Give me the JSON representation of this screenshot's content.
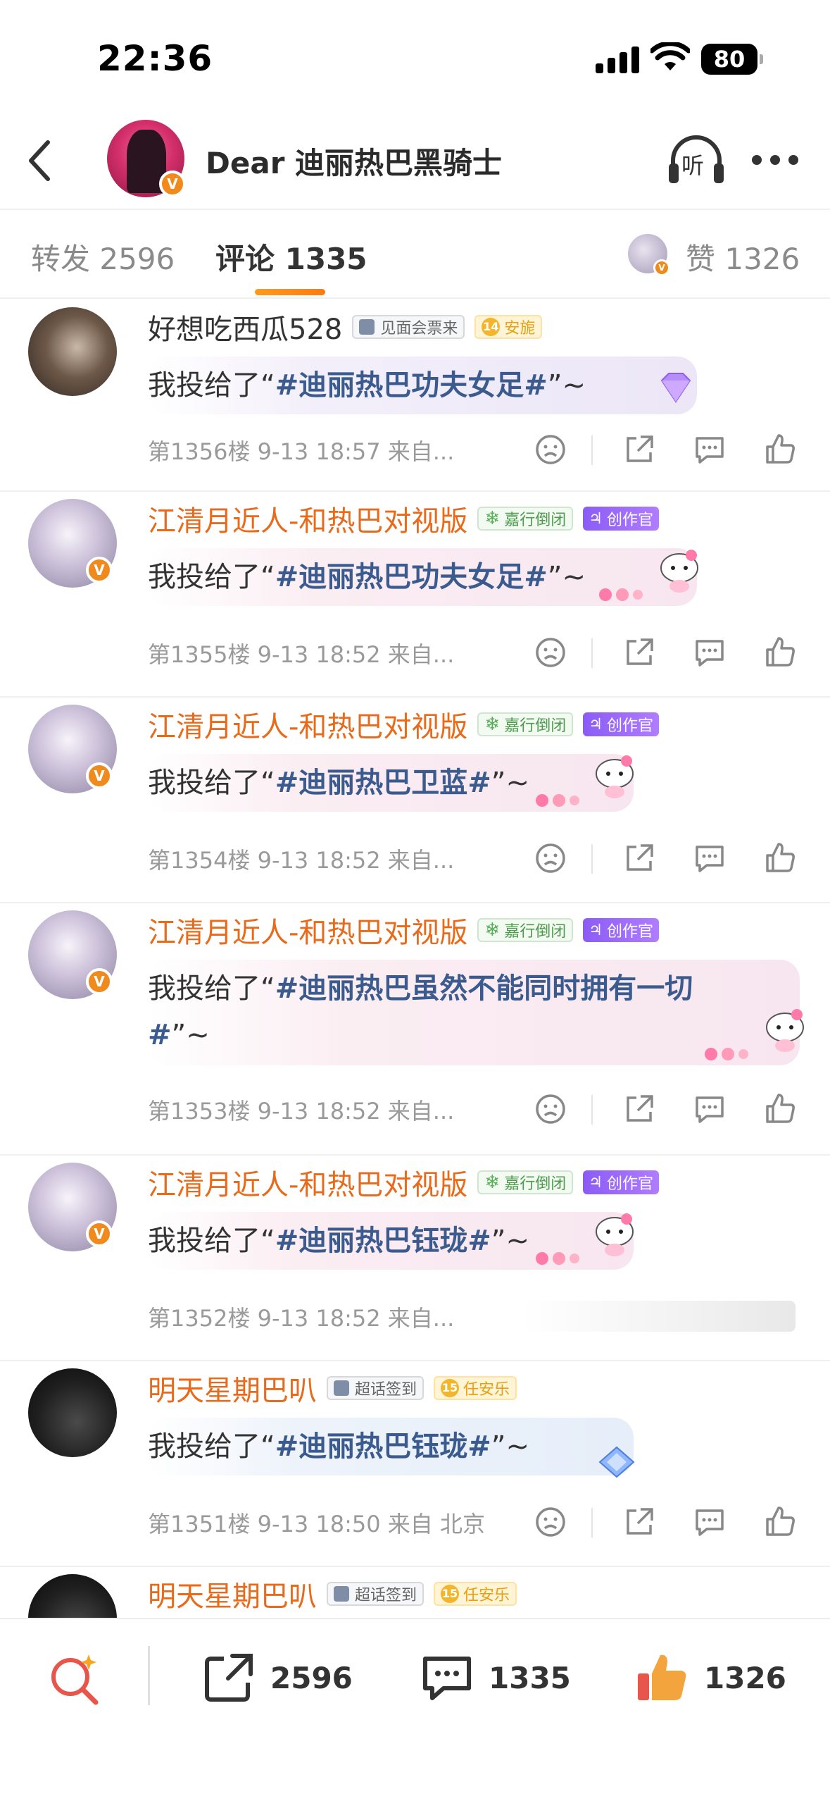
{
  "status_bar": {
    "time": "22:36",
    "battery": "80"
  },
  "header": {
    "title": "Dear 迪丽热巴黑骑士",
    "listen_label": "听"
  },
  "tabs": [
    {
      "label": "转发 2596",
      "active": false
    },
    {
      "label": "评论 1335",
      "active": true
    },
    {
      "label": "赞 1326",
      "active": false
    }
  ],
  "comments": [
    {
      "user": "好想吃西瓜528",
      "name_color": "gray",
      "badges": [
        {
          "text": "见面会票来",
          "style": "gray"
        },
        {
          "text": "安旎",
          "level": "14",
          "style": "yellow"
        }
      ],
      "text_prefix": "我投给了“",
      "tag": "#迪丽热巴功夫女足#",
      "text_suffix": "”~",
      "meta": "第1356楼 9-13 18:57 来自..."
    },
    {
      "user": "江清月近人-和热巴对视版",
      "name_color": "orange",
      "badges": [
        {
          "text": "嘉行倒闭",
          "style": "green"
        },
        {
          "text": "创作官",
          "style": "purple"
        }
      ],
      "text_prefix": "我投给了“",
      "tag": "#迪丽热巴功夫女足#",
      "text_suffix": "”~",
      "meta": "第1355楼 9-13 18:52 来自..."
    },
    {
      "user": "江清月近人-和热巴对视版",
      "name_color": "orange",
      "badges": [
        {
          "text": "嘉行倒闭",
          "style": "green"
        },
        {
          "text": "创作官",
          "style": "purple"
        }
      ],
      "text_prefix": "我投给了“",
      "tag": "#迪丽热巴卫蓝#",
      "text_suffix": "”~",
      "meta": "第1354楼 9-13 18:52 来自..."
    },
    {
      "user": "江清月近人-和热巴对视版",
      "name_color": "orange",
      "badges": [
        {
          "text": "嘉行倒闭",
          "style": "green"
        },
        {
          "text": "创作官",
          "style": "purple"
        }
      ],
      "text_prefix": "我投给了“",
      "tag": "#迪丽热巴虽然不能同时拥有一切",
      "tag_line2": "#",
      "text_suffix": "”~",
      "meta": "第1353楼 9-13 18:52 来自..."
    },
    {
      "user": "江清月近人-和热巴对视版",
      "name_color": "orange",
      "badges": [
        {
          "text": "嘉行倒闭",
          "style": "green"
        },
        {
          "text": "创作官",
          "style": "purple"
        }
      ],
      "text_prefix": "我投给了“",
      "tag": "#迪丽热巴钰珑#",
      "text_suffix": "”~",
      "meta": "第1352楼 9-13 18:52 来自..."
    },
    {
      "user": "明天星期巴叭",
      "name_color": "orange",
      "badges": [
        {
          "text": "超话签到",
          "style": "gray"
        },
        {
          "text": "任安乐",
          "level": "15",
          "style": "yellow"
        }
      ],
      "text_prefix": "我投给了“",
      "tag": "#迪丽热巴钰珑#",
      "text_suffix": "”~",
      "meta": "第1351楼 9-13 18:50 来自 北京"
    },
    {
      "user": "明天星期巴叭",
      "name_color": "orange",
      "badges": [
        {
          "text": "超话签到",
          "style": "gray"
        },
        {
          "text": "任安乐",
          "level": "15",
          "style": "yellow"
        }
      ]
    }
  ],
  "bottom_bar": {
    "repost_count": "2596",
    "comment_count": "1335",
    "like_count": "1326"
  },
  "colors": {
    "accent_orange": "#ff8200",
    "username_orange": "#e86a1a",
    "tag_blue": "#3b5b8f"
  }
}
